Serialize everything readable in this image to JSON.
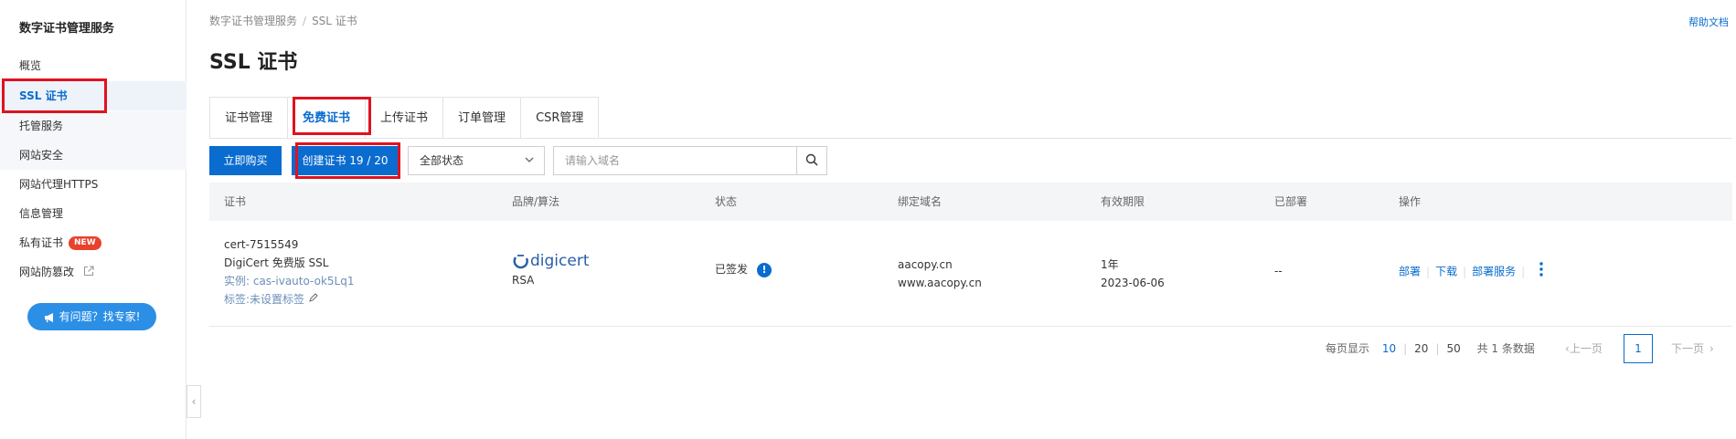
{
  "sidebar": {
    "title": "数字证书管理服务",
    "items": [
      {
        "label": "概览"
      },
      {
        "label": "SSL 证书"
      },
      {
        "label": "托管服务"
      },
      {
        "label": "网站安全"
      },
      {
        "label": "网站代理HTTPS"
      },
      {
        "label": "信息管理"
      },
      {
        "label": "私有证书",
        "badge": "NEW"
      },
      {
        "label": "网站防篡改"
      }
    ],
    "help_button": "有问题？找专家!",
    "collapse_glyph": "‹"
  },
  "breadcrumb": {
    "root": "数字证书管理服务",
    "separator": "/",
    "current": "SSL 证书"
  },
  "help_doc": "帮助文档",
  "page_title": "SSL 证书",
  "tabs": [
    {
      "label": "证书管理"
    },
    {
      "label": "免费证书"
    },
    {
      "label": "上传证书"
    },
    {
      "label": "订单管理"
    },
    {
      "label": "CSR管理"
    }
  ],
  "toolbar": {
    "buy_button": "立即购买",
    "create_button": "创建证书 19 / 20",
    "status_select_value": "全部状态",
    "search_placeholder": "请输入域名"
  },
  "table": {
    "headers": [
      "证书",
      "品牌/算法",
      "状态",
      "绑定域名",
      "有效期限",
      "已部署",
      "操作"
    ],
    "rows": [
      {
        "cert_id": "cert-7515549",
        "cert_name": "DigiCert 免费版 SSL",
        "instance": "实例: cas-ivauto-ok5Lq1",
        "tags": "标签:未设置标签",
        "brand": "digicert",
        "algorithm": "RSA",
        "status": "已签发",
        "status_icon": "!",
        "domains": [
          "aacopy.cn",
          "www.aacopy.cn"
        ],
        "validity": "1年",
        "expiry": "2023-06-06",
        "deployed": "--",
        "actions": [
          "部署",
          "下载",
          "部署服务"
        ]
      }
    ]
  },
  "pagination": {
    "per_page_label": "每页显示",
    "sizes": [
      "10",
      "20",
      "50"
    ],
    "active_size": "10",
    "total": "共 1 条数据",
    "prev": "上一页",
    "current_page": "1",
    "next": "下一页"
  },
  "colors": {
    "accent": "#0a6ccf",
    "highlight_box": "#e0121f",
    "new_badge": "#e8412c"
  }
}
